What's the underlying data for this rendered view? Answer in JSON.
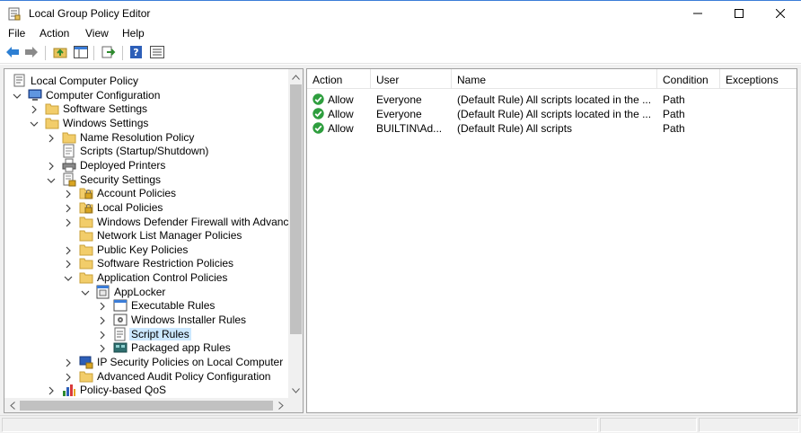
{
  "window": {
    "title": "Local Group Policy Editor",
    "icon": "policy-editor-icon",
    "controls": [
      "minimize",
      "maximize",
      "close"
    ]
  },
  "menu": [
    "File",
    "Action",
    "View",
    "Help"
  ],
  "toolbar": {
    "buttons": [
      "back-arrow-icon",
      "forward-arrow-icon",
      "up-folder-icon",
      "show-hide-tree-icon",
      "export-list-icon",
      "help-icon",
      "properties-icon"
    ]
  },
  "tree": {
    "items": [
      {
        "label": "Local Computer Policy",
        "level": 0,
        "expander": "none",
        "icon": "policy-computer-icon"
      },
      {
        "label": "Computer Configuration",
        "level": 1,
        "expander": "expanded",
        "icon": "computer-icon"
      },
      {
        "label": "Software Settings",
        "level": 2,
        "expander": "collapsed",
        "icon": "folder-icon"
      },
      {
        "label": "Windows Settings",
        "level": 2,
        "expander": "expanded",
        "icon": "folder-icon"
      },
      {
        "label": "Name Resolution Policy",
        "level": 3,
        "expander": "collapsed",
        "icon": "folder-icon"
      },
      {
        "label": "Scripts (Startup/Shutdown)",
        "level": 3,
        "expander": "none",
        "icon": "script-icon"
      },
      {
        "label": "Deployed Printers",
        "level": 3,
        "expander": "collapsed",
        "icon": "printer-icon"
      },
      {
        "label": "Security Settings",
        "level": 3,
        "expander": "expanded",
        "icon": "security-settings-icon"
      },
      {
        "label": "Account Policies",
        "level": 4,
        "expander": "collapsed",
        "icon": "locked-folder-icon"
      },
      {
        "label": "Local Policies",
        "level": 4,
        "expander": "collapsed",
        "icon": "locked-folder-icon"
      },
      {
        "label": "Windows Defender Firewall with Advanc",
        "level": 4,
        "expander": "collapsed",
        "icon": "folder-icon"
      },
      {
        "label": "Network List Manager Policies",
        "level": 4,
        "expander": "none",
        "icon": "folder-icon"
      },
      {
        "label": "Public Key Policies",
        "level": 4,
        "expander": "collapsed",
        "icon": "folder-icon"
      },
      {
        "label": "Software Restriction Policies",
        "level": 4,
        "expander": "collapsed",
        "icon": "folder-icon"
      },
      {
        "label": "Application Control Policies",
        "level": 4,
        "expander": "expanded",
        "icon": "folder-icon"
      },
      {
        "label": "AppLocker",
        "level": 5,
        "expander": "expanded",
        "icon": "applocker-icon"
      },
      {
        "label": "Executable Rules",
        "level": 6,
        "expander": "collapsed",
        "icon": "executable-rules-icon"
      },
      {
        "label": "Windows Installer Rules",
        "level": 6,
        "expander": "collapsed",
        "icon": "installer-rules-icon"
      },
      {
        "label": "Script Rules",
        "level": 6,
        "expander": "collapsed",
        "icon": "script-rules-icon",
        "selected": true
      },
      {
        "label": "Packaged app Rules",
        "level": 6,
        "expander": "collapsed",
        "icon": "packaged-app-rules-icon"
      },
      {
        "label": "IP Security Policies on Local Computer",
        "level": 4,
        "expander": "collapsed",
        "icon": "ip-security-icon"
      },
      {
        "label": "Advanced Audit Policy Configuration",
        "level": 4,
        "expander": "collapsed",
        "icon": "folder-icon"
      },
      {
        "label": "Policy-based QoS",
        "level": 3,
        "expander": "collapsed",
        "icon": "qos-chart-icon"
      }
    ]
  },
  "list": {
    "columns": [
      "Action",
      "User",
      "Name",
      "Condition",
      "Exceptions"
    ],
    "rows": [
      {
        "action": "Allow",
        "user": "Everyone",
        "name": "(Default Rule) All scripts located in the ...",
        "condition": "Path",
        "exceptions": "",
        "icon": "allow-check-icon"
      },
      {
        "action": "Allow",
        "user": "Everyone",
        "name": "(Default Rule) All scripts located in the ...",
        "condition": "Path",
        "exceptions": "",
        "icon": "allow-check-icon"
      },
      {
        "action": "Allow",
        "user": "BUILTIN\\Ad...",
        "name": "(Default Rule) All scripts",
        "condition": "Path",
        "exceptions": "",
        "icon": "allow-check-icon"
      }
    ]
  },
  "colors": {
    "selection": "#cce8ff",
    "allow_green": "#2e9e3e",
    "folder_yellow": "#e8c25a"
  }
}
